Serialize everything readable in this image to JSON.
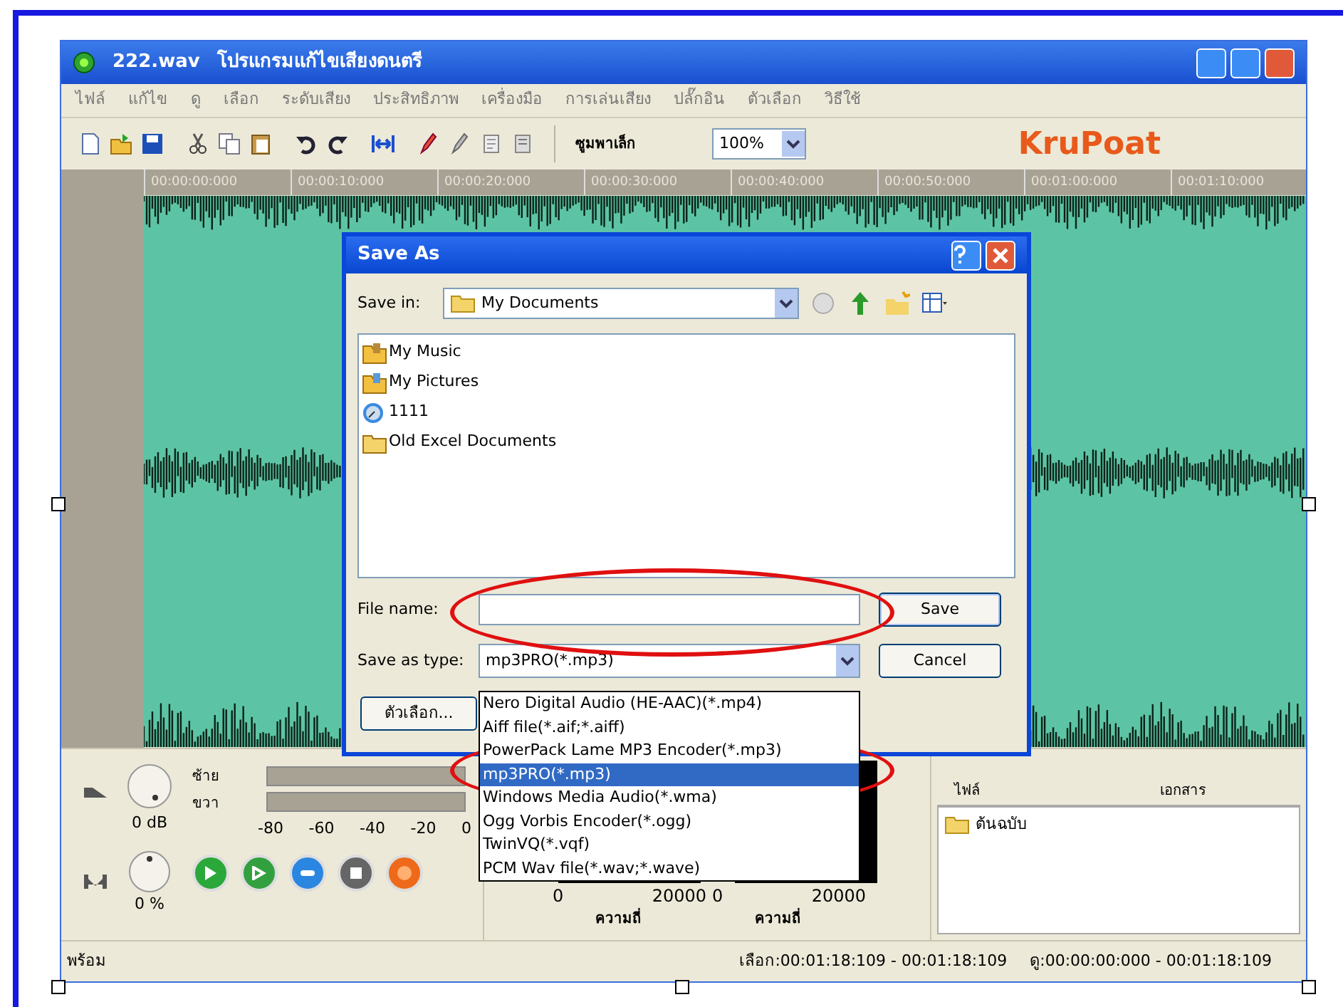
{
  "window": {
    "file": "222.wav",
    "title": "โปรแกรมแก้ไขเสียงดนตรี"
  },
  "menu": [
    "ไฟล์",
    "แก้ไข",
    "ดู",
    "เลือก",
    "ระดับเสียง",
    "ประสิทธิภาพ",
    "เครื่องมือ",
    "การเล่นเสียง",
    "ปลั๊กอิน",
    "ตัวเลือก",
    "วิธีใช้"
  ],
  "toolbar": {
    "zoom_label": "ซูมพาเล็ก",
    "zoom": "100%",
    "logo": "KruPoat"
  },
  "timeline": [
    "00:00:00:000",
    "00:00:10:000",
    "00:00:20:000",
    "00:00:30:000",
    "00:00:40:000",
    "00:00:50:000",
    "00:01:00:000",
    "00:01:10:000"
  ],
  "meters": {
    "left_label": "ซ้าย",
    "right_label": "ขวา",
    "scale": [
      "-80",
      "-60",
      "-40",
      "-20",
      "0"
    ],
    "gain": "0 dB",
    "speed": "0 %"
  },
  "transport": [
    {
      "kind": "play"
    },
    {
      "kind": "play-selection"
    },
    {
      "kind": "loop"
    },
    {
      "kind": "stop"
    },
    {
      "kind": "record"
    }
  ],
  "spectrum": {
    "ticks": [
      "0",
      "20000",
      "0",
      "20000"
    ],
    "xlabels": [
      "ความถี่",
      "ความถี่"
    ]
  },
  "files_panel": {
    "columns": [
      "ไฟล์",
      "เอกสาร"
    ],
    "items": [
      "ต้นฉบับ"
    ]
  },
  "status_bar": {
    "state": "พร้อม",
    "selection": "เลือก:00:01:18:109 - 00:01:18:109",
    "view": "ดู:00:00:00:000 - 00:01:18:109"
  },
  "dialog": {
    "title": "Save As",
    "save_in_label": "Save in:",
    "save_in": "My Documents",
    "items": [
      {
        "name": "My Music",
        "kind": "music"
      },
      {
        "name": "My Pictures",
        "kind": "pictures"
      },
      {
        "name": "1111",
        "kind": "shortcut"
      },
      {
        "name": "Old Excel Documents",
        "kind": "folder"
      }
    ],
    "file_name_label": "File name:",
    "type_label": "Save as type:",
    "type": "mp3PRO(*.mp3)",
    "options_button": "ตัวเลือก...",
    "buttons": [
      "Save",
      "Cancel"
    ],
    "type_options": [
      {
        "label": "Nero Digital Audio (HE-AAC)(*.mp4)",
        "selected": false
      },
      {
        "label": "Aiff file(*.aif;*.aiff)",
        "selected": false
      },
      {
        "label": "PowerPack Lame MP3 Encoder(*.mp3)",
        "selected": false
      },
      {
        "label": "mp3PRO(*.mp3)",
        "selected": true
      },
      {
        "label": "Windows Media Audio(*.wma)",
        "selected": false
      },
      {
        "label": "Ogg Vorbis Encoder(*.ogg)",
        "selected": false
      },
      {
        "label": "TwinVQ(*.vqf)",
        "selected": false
      },
      {
        "label": "PCM Wav file(*.wav;*.wave)",
        "selected": false
      }
    ]
  }
}
